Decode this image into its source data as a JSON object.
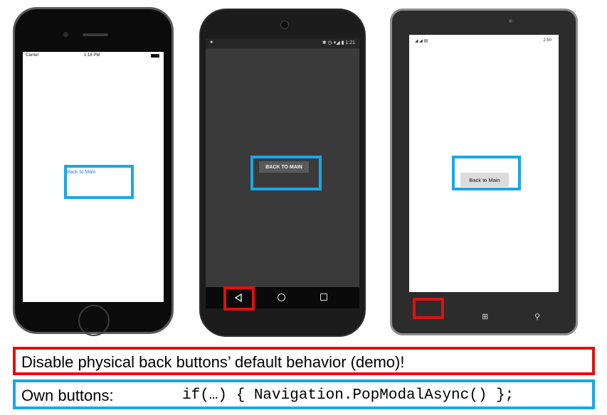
{
  "ios": {
    "carrier": "Carrier",
    "wifi_icon": "wifi-icon",
    "time": "1:18 PM",
    "button_label": "Back to Main"
  },
  "android": {
    "status_right": "✱ ◷ ▾◢ ▮ 1:21",
    "button_label": "BACK TO MAIN",
    "nav_back_icon": "triangle-back-icon",
    "nav_home_icon": "circle-home-icon",
    "nav_recent_icon": "square-recents-icon"
  },
  "winphone": {
    "status_left": "◢ ◢ ▤",
    "status_right": "2:50",
    "button_label": "Back to Main",
    "nav_back_glyph": "←",
    "nav_windows_glyph": "⊞",
    "nav_search_glyph": "⚲"
  },
  "captions": {
    "red_caption": "Disable physical back buttons’ default behavior (demo)!",
    "blue_caption_label": "Own buttons:",
    "blue_caption_code": "if(…) { Navigation.PopModalAsync() };"
  },
  "colors": {
    "highlight_blue": "#17a8e8",
    "highlight_red": "#e01010",
    "ios_link": "#2e7be6"
  }
}
